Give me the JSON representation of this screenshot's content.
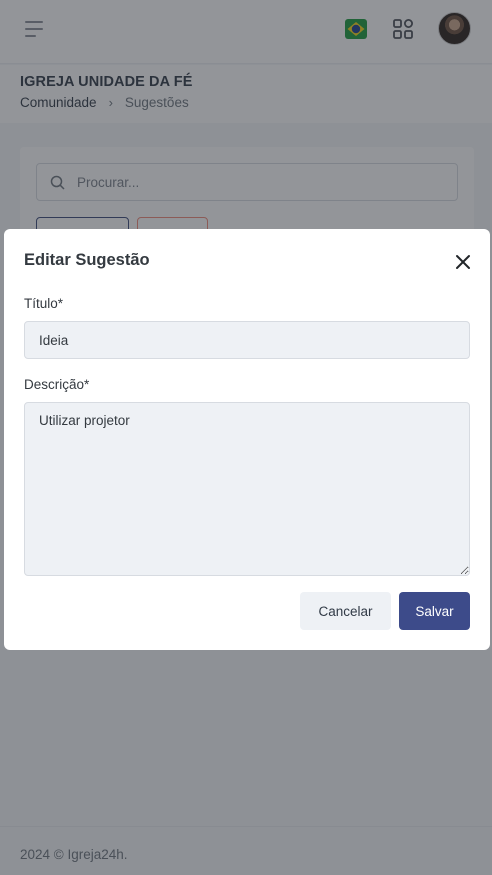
{
  "header": {
    "menu_icon": "hamburger-menu-icon",
    "language_icon": "brazil-flag-icon",
    "apps_icon": "apps-grid-icon",
    "avatar_icon": "user-avatar"
  },
  "page": {
    "title": "IGREJA UNIDADE DA FÉ",
    "breadcrumb": {
      "parent": "Comunidade",
      "separator": "›",
      "current": "Sugestões"
    }
  },
  "content": {
    "search": {
      "placeholder": "Procurar...",
      "icon": "search-icon"
    }
  },
  "modal": {
    "title": "Editar Sugestão",
    "close_icon": "close-icon",
    "fields": {
      "title_label": "Título*",
      "title_value": "Ideia",
      "description_label": "Descrição*",
      "description_value": "Utilizar projetor"
    },
    "buttons": {
      "cancel": "Cancelar",
      "save": "Salvar"
    }
  },
  "footer": {
    "text": "2024 © Igreja24h."
  },
  "colors": {
    "primary": "#3d4b8a",
    "danger_outline": "#f08a7a",
    "input_background": "#eef1f5",
    "overlay": "rgba(40,44,52,0.5)"
  }
}
